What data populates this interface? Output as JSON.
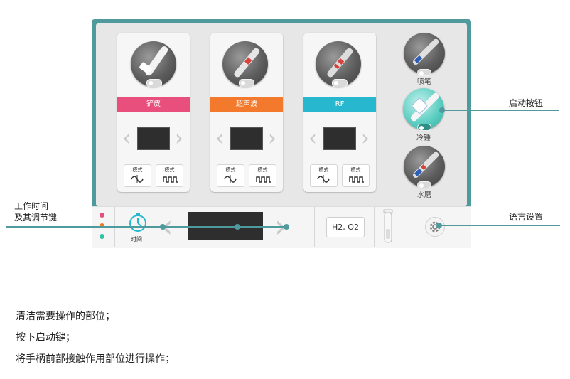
{
  "cards": [
    {
      "label": "铲皮",
      "color": "#e94f7c",
      "mode_left": "模式",
      "mode_right": "模式"
    },
    {
      "label": "超声波",
      "color": "#f37a2d",
      "mode_left": "模式",
      "mode_right": "模式"
    },
    {
      "label": "RF",
      "color": "#27b8cf",
      "mode_left": "模式",
      "mode_right": "模式"
    }
  ],
  "side": {
    "item1": "喷笔",
    "item2": "冷锤",
    "item3": "水磨"
  },
  "bottom": {
    "timer_label": "时间",
    "gas_label": "H2, O2"
  },
  "annotations": {
    "start_button": "启动按钮",
    "time_control_line1": "工作时间",
    "time_control_line2": "及其调节键",
    "language": "语言设置"
  },
  "instructions": [
    "清洁需要操作的部位；",
    "按下启动键；",
    "将手柄前部接触作用部位进行操作；"
  ],
  "colors": {
    "frame": "#4f9a9d",
    "pink": "#e94f7c",
    "orange": "#f37a2d",
    "cyan": "#27b8cf"
  }
}
